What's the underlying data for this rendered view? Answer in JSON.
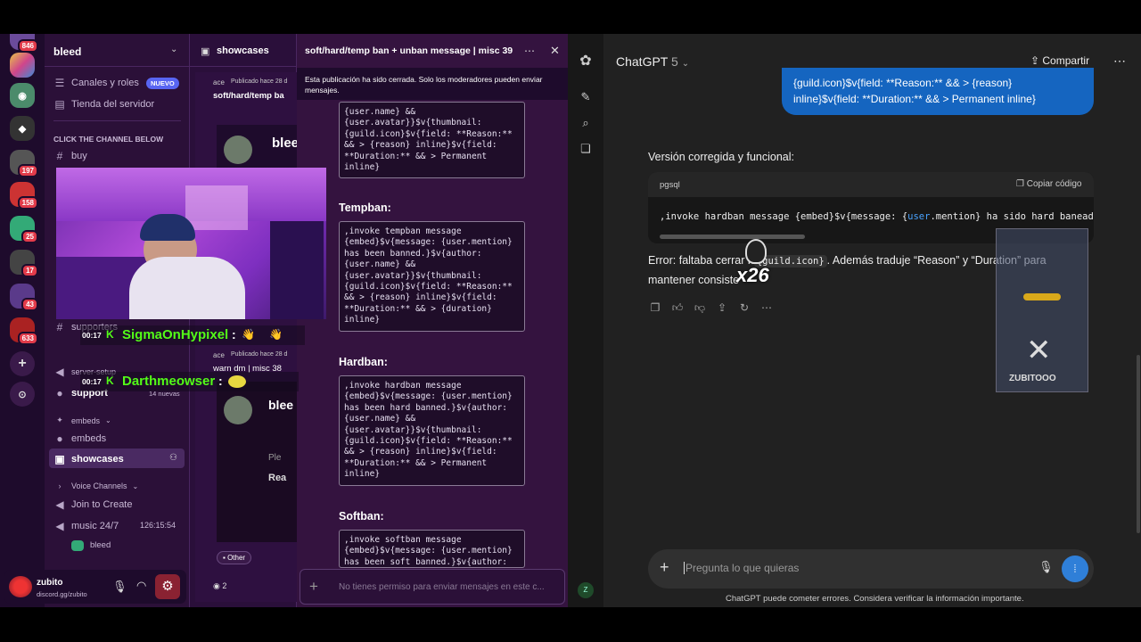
{
  "discord": {
    "server_name": "bleed",
    "nav": {
      "roles_label": "Canales y roles",
      "roles_badge": "NUEVO",
      "store_label": "Tienda del servidor"
    },
    "category_click": "CLICK THE CHANNEL BELOW",
    "channel_buy": "buy",
    "channel_supporters": "supporters",
    "channel_server_setup": "server-setup",
    "channel_support": "support",
    "support_new": "14 nuevas",
    "category_embeds": "embeds",
    "channel_embeds": "embeds",
    "channel_showcases": "showcases",
    "category_voice": "Voice Channels",
    "voice_join": "Join to Create",
    "voice_music": "music 24/7",
    "voice_music_timer": "126:15:54",
    "voice_member": "bleed",
    "user": {
      "name": "zubito",
      "status": "discord.gg/zubito"
    },
    "server_badges": [
      "846",
      "197",
      "158",
      "25",
      "17",
      "43",
      "633"
    ],
    "posts_header": "showcases",
    "post1": {
      "author": "ace",
      "meta": "Publicado hace 28 d",
      "title": "soft/hard/temp ba",
      "preview": "blee"
    },
    "post2": {
      "author": "ace",
      "meta": "Publicado hace 28 d",
      "title": "warn dm | misc 38",
      "preview": "blee",
      "sub1": "Ple",
      "sub2": "Rea"
    },
    "post_tag": "Other",
    "post_replies": "2",
    "thread": {
      "title": "soft/hard/temp ban + unban message | misc 39",
      "closed_notice": "Esta publicación ha sido cerrada. Solo los moderadores pueden enviar mensajes.",
      "code_top": "{user.name} &&\n{user.avatar}}$v{thumbnail:\n{guild.icon}$v{field: **Reason:**\n&& > {reason} inline}$v{field:\n**Duration:** && > Permanent\ninline}",
      "tempban_title": "Tempban:",
      "tempban_code": ",invoke tempban message\n{embed}$v{message: {user.mention}\nhas been banned.}$v{author:\n{user.name} &&\n{user.avatar}}$v{thumbnail:\n{guild.icon}$v{field: **Reason:**\n&& > {reason} inline}$v{field:\n**Duration:** && > {duration}\ninline}",
      "hardban_title": "Hardban:",
      "hardban_code": ",invoke hardban message\n{embed}$v{message: {user.mention}\nhas been hard banned.}$v{author:\n{user.name} &&\n{user.avatar}}$v{thumbnail:\n{guild.icon}$v{field: **Reason:**\n&& > {reason} inline}$v{field:\n**Duration:** && > Permanent\ninline}",
      "softban_title": "Softban:",
      "softban_code": ",invoke softban message\n{embed}$v{message: {user.mention}\nhas been soft banned.}$v{author:",
      "input_placeholder": "No tienes permiso para enviar mensajes en este c..."
    }
  },
  "stream": {
    "chat1_time": "00:17",
    "chat1_user": "SigmaOnHypixel",
    "chat2_time": "00:17",
    "chat2_user": "Darthmeowser",
    "combo": "x26",
    "watermark": "ZUBITOOO"
  },
  "chatgpt": {
    "model": "ChatGPT",
    "model_version": "5",
    "share_label": "Compartir",
    "user_bubble_line1": "{guild.icon}$v{field: **Reason:** && > {reason}",
    "user_bubble_line2": "inline}$v{field: **Duration:** && > Permanent inline}",
    "reply_intro": "Versión corregida y funcional:",
    "code_lang": "pgsql",
    "copy_label": "Copiar código",
    "code_pre": ",invoke hardban message {embed}$v{message: {",
    "code_kw": "user",
    "code_post": ".mention} ha sido hard baneado.}$",
    "error_pre": "Error: faltaba cerrar",
    "error_mid": "n",
    "error_code": "{guild.icon}",
    "error_post": ". Además traduje “Reason” y “Duration” para",
    "error_line2": "mantener consiste",
    "input_placeholder": "Pregunta lo que quieras",
    "disclaimer": "ChatGPT puede cometer errores. Considera verificar la información importante.",
    "avatar_letter": "Z"
  },
  "colors": {
    "discord_bg": "#3b1450",
    "gpt_bg": "#212121",
    "user_bubble": "#1565c0",
    "kick_green": "#53fc18",
    "voice_btn": "#2f7fd8"
  }
}
